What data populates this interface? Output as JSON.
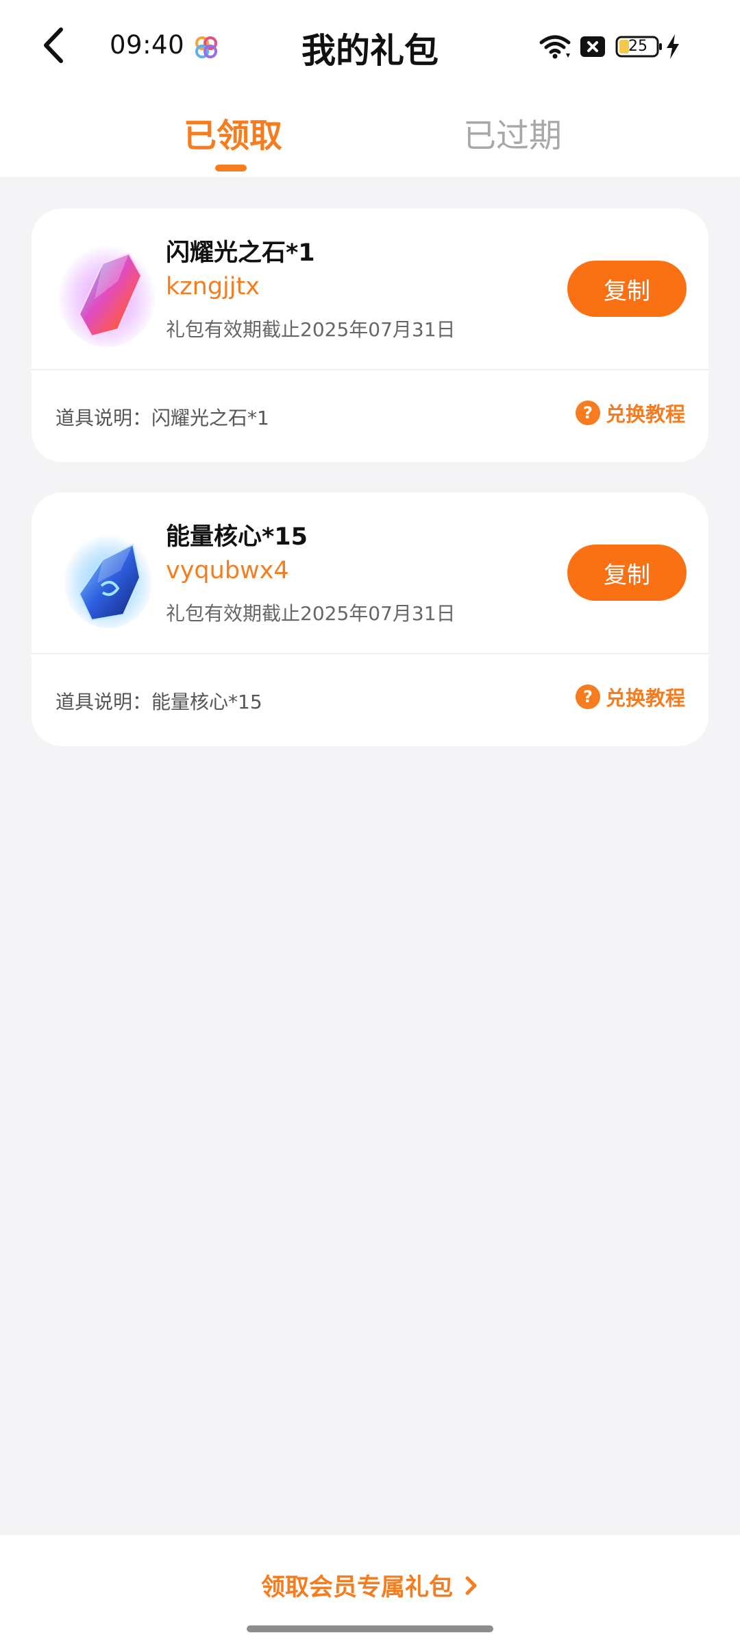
{
  "status_bar": {
    "time": "09:40",
    "battery_level": "25",
    "app_icon": "colorful-app-icon",
    "icons": [
      "wifi-icon",
      "sim-blocked-icon",
      "battery-icon",
      "charging-icon"
    ]
  },
  "header": {
    "title": "我的礼包",
    "back_icon": "chevron-left-icon"
  },
  "tabs": [
    {
      "label": "已领取",
      "active": true
    },
    {
      "label": "已过期",
      "active": false
    }
  ],
  "gifts": [
    {
      "name": "闪耀光之石*1",
      "code": "kzngjjtx",
      "expiry": "礼包有效期截止2025年07月31日",
      "copy_label": "复制",
      "description": "道具说明：闪耀光之石*1",
      "tutorial_label": "兑换教程",
      "icon": "pink-crystal-icon"
    },
    {
      "name": "能量核心*15",
      "code": "vyqubwx4",
      "expiry": "礼包有效期截止2025年07月31日",
      "copy_label": "复制",
      "description": "道具说明：能量核心*15",
      "tutorial_label": "兑换教程",
      "icon": "blue-crystal-icon"
    }
  ],
  "footer": {
    "member_link": "领取会员专属礼包"
  },
  "colors": {
    "accent": "#f57d1f",
    "button": "#fa7114",
    "background": "#f4f3f5"
  }
}
